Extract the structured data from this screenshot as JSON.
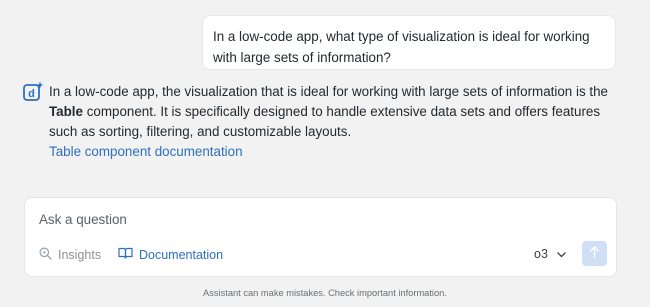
{
  "conversation": {
    "user_message": "In a low-code app, what type of visualization is ideal for working with large sets of information?",
    "assistant": {
      "text_before_bold": "In a low-code app, the visualization that is ideal for working with large sets of information is the ",
      "bold_term": "Table",
      "text_after_bold": " component. It is specifically designed to handle extensive data sets and offers features such as sorting, filtering, and customizable layouts.",
      "link_label": "Table component documentation"
    }
  },
  "composer": {
    "placeholder": "Ask a question",
    "insights_label": "Insights",
    "documentation_label": "Documentation",
    "model_label": "o3"
  },
  "footer": {
    "disclaimer": "Assistant can make mistakes. Check important information."
  },
  "colors": {
    "accent": "#2f6fbf",
    "send_button": "#cfe0f5",
    "background": "#f1f2f1"
  },
  "icons": {
    "assistant": "assistant-d-sparkle-icon",
    "insights": "magnifier-sparkle-icon",
    "documentation": "open-book-icon",
    "model_dropdown": "chevron-down-icon",
    "send": "arrow-up-icon"
  }
}
